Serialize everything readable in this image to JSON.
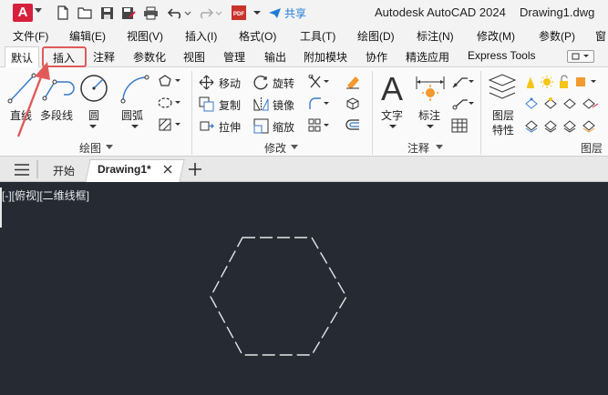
{
  "app": {
    "logo_letter": "A",
    "title": "Autodesk AutoCAD 2024",
    "document": "Drawing1.dwg",
    "share_label": "共享",
    "pdf_label": "PDF"
  },
  "menu": [
    "文件(F)",
    "编辑(E)",
    "视图(V)",
    "插入(I)",
    "格式(O)",
    "工具(T)",
    "绘图(D)",
    "标注(N)",
    "修改(M)",
    "参数(P)",
    "窗"
  ],
  "ribbon_tabs": [
    "默认",
    "插入",
    "注释",
    "参数化",
    "视图",
    "管理",
    "输出",
    "附加模块",
    "协作",
    "精选应用",
    "Express Tools"
  ],
  "draw_panel": {
    "tools": [
      "直线",
      "多段线",
      "圆",
      "圆弧"
    ],
    "title": "绘图"
  },
  "modify_panel": {
    "tools": [
      "移动",
      "旋转",
      "复制",
      "镜像",
      "拉伸",
      "缩放"
    ],
    "title": "修改"
  },
  "annotation_panel": {
    "tools": [
      "文字",
      "标注"
    ],
    "title": "注释"
  },
  "layers_panel": {
    "tools": [
      "图层",
      "特性"
    ],
    "title": "图层"
  },
  "doc_tabs": {
    "start": "开始",
    "active": "Drawing1*"
  },
  "viewport": {
    "label": "[-][俯视][二维线框]"
  },
  "colors": {
    "canvas": "#252a33",
    "accent_red": "#e05a5a",
    "share_blue": "#1e7bd6",
    "autocad_red": "#d6203c"
  }
}
